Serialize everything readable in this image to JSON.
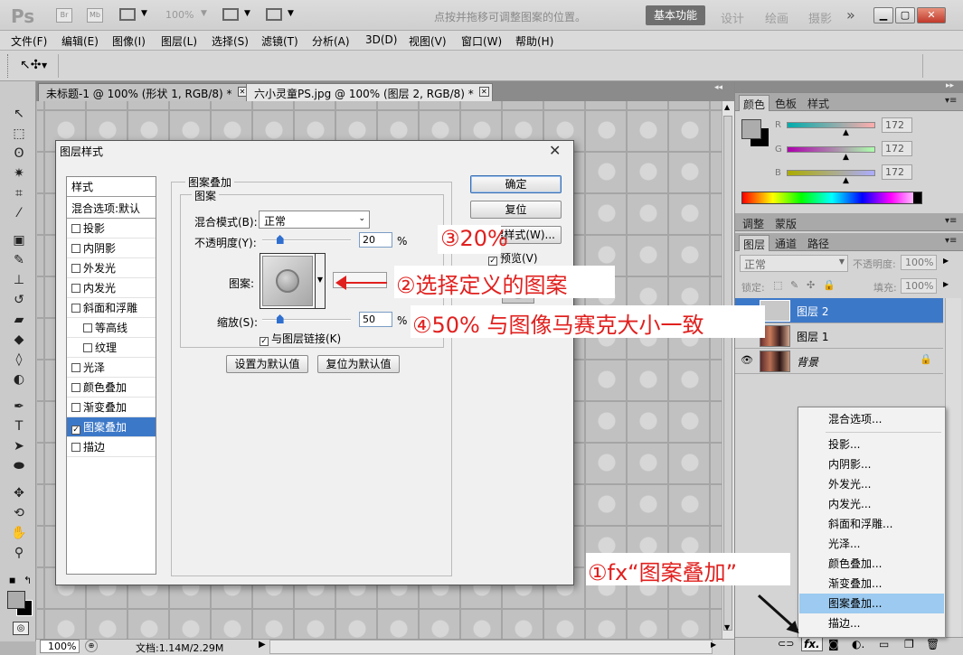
{
  "app": {
    "logo": "Ps",
    "title_icons": [
      "Br",
      "Mb"
    ],
    "zoom": "100%"
  },
  "workspaces": {
    "active": "基本功能",
    "others": [
      "设计",
      "绘画",
      "摄影"
    ],
    "more": "»"
  },
  "menu": [
    "文件(F)",
    "编辑(E)",
    "图像(I)",
    "图层(L)",
    "选择(S)",
    "滤镜(T)",
    "分析(A)",
    "3D(D)",
    "视图(V)",
    "窗口(W)",
    "帮助(H)"
  ],
  "options_bar": {
    "hint": "点按并拖移可调整图案的位置。"
  },
  "tabs": [
    {
      "label": "未标题-1 @ 100% (形状 1, RGB/8) *",
      "active": false
    },
    {
      "label": "六小灵童PS.jpg @ 100% (图层 2, RGB/8) *",
      "active": true
    }
  ],
  "status": {
    "zoom": "100%",
    "doc": "文档:1.14M/2.29M"
  },
  "color_panel": {
    "tabs": [
      "颜色",
      "色板",
      "样式"
    ],
    "channels": [
      {
        "label": "R",
        "value": "172"
      },
      {
        "label": "G",
        "value": "172"
      },
      {
        "label": "B",
        "value": "172"
      }
    ]
  },
  "adjust_panel": {
    "tabs": [
      "调整",
      "蒙版"
    ]
  },
  "layers_panel": {
    "tabs": [
      "图层",
      "通道",
      "路径"
    ],
    "blend_mode": "正常",
    "opacity_label": "不透明度:",
    "opacity": "100%",
    "lock_label": "锁定:",
    "fill_label": "填充:",
    "fill": "100%",
    "layers": [
      {
        "name": "图层 2",
        "selected": true
      },
      {
        "name": "图层 1",
        "selected": false
      },
      {
        "name": "背景",
        "selected": false
      }
    ]
  },
  "context_menu": {
    "items": [
      "混合选项...",
      "投影...",
      "内阴影...",
      "外发光...",
      "内发光...",
      "斜面和浮雕...",
      "光泽...",
      "颜色叠加...",
      "渐变叠加...",
      "图案叠加...",
      "描边..."
    ],
    "selected": "图案叠加..."
  },
  "dialog": {
    "title": "图层样式",
    "styles_header": "样式",
    "blend_options": "混合选项:默认",
    "styles": [
      {
        "label": "投影",
        "checked": false,
        "sub": false
      },
      {
        "label": "内阴影",
        "checked": false,
        "sub": false
      },
      {
        "label": "外发光",
        "checked": false,
        "sub": false
      },
      {
        "label": "内发光",
        "checked": false,
        "sub": false
      },
      {
        "label": "斜面和浮雕",
        "checked": false,
        "sub": false
      },
      {
        "label": "等高线",
        "checked": false,
        "sub": true
      },
      {
        "label": "纹理",
        "checked": false,
        "sub": true
      },
      {
        "label": "光泽",
        "checked": false,
        "sub": false
      },
      {
        "label": "颜色叠加",
        "checked": false,
        "sub": false
      },
      {
        "label": "渐变叠加",
        "checked": false,
        "sub": false
      },
      {
        "label": "图案叠加",
        "checked": true,
        "sub": false,
        "selected": true
      },
      {
        "label": "描边",
        "checked": false,
        "sub": false
      }
    ],
    "group_title": "图案叠加",
    "subgroup_title": "图案",
    "blend_mode_label": "混合模式(B):",
    "blend_mode_value": "正常",
    "opacity_label": "不透明度(Y):",
    "opacity_value": "20",
    "opacity_level": 0.2,
    "percent": "%",
    "pattern_label": "图案:",
    "scale_label": "缩放(S):",
    "scale_value": "50",
    "scale_level": 0.2,
    "link_label": "与图层链接(K)",
    "set_default": "设置为默认值",
    "reset_default": "复位为默认值",
    "ok": "确定",
    "reset": "复位",
    "new_style": "新建样式(W)...",
    "preview": "预览(V)"
  },
  "annotations": {
    "step1": "①fx“图案叠加”",
    "step2": "②选择定义的图案",
    "step3": "③20%",
    "step4": "④50% 与图像马赛克大小一致"
  },
  "colors": {
    "accent": "#3c78c8",
    "annotation": "#e0201e",
    "selection": "#9ccaf0"
  }
}
